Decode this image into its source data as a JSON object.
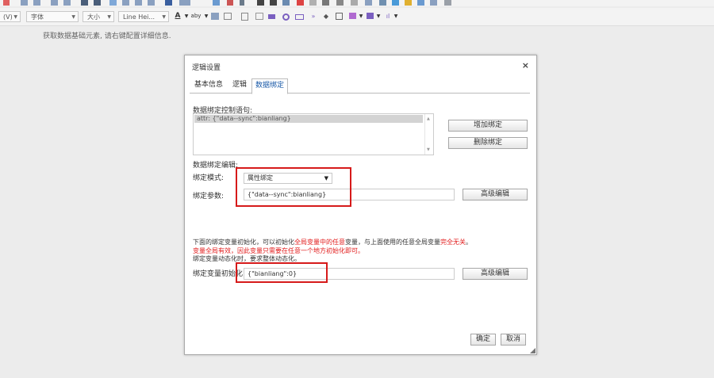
{
  "toolbar_top": {
    "icons": [
      "format-icon",
      "list-icon",
      "list-icon",
      "indent-icon",
      "indent-icon",
      "quote-icon",
      "bold-icon",
      "align-left-icon",
      "align-center-icon",
      "align-right-icon",
      "align-justify-icon",
      "text-color-icon",
      "highlight-icon",
      "link-icon",
      "unlink-icon",
      "anchor-icon",
      "image-icon",
      "video-icon",
      "map-icon",
      "code-icon",
      "template-icon",
      "chart-icon",
      "emoji-icon",
      "special-char-icon",
      "undo-icon",
      "redo-icon",
      "eraser-icon"
    ]
  },
  "toolbar": {
    "paragraph_label": "(V)",
    "font_family_label": "字体",
    "font_size_label": "大小",
    "line_height_label": "Line Hei...",
    "font_color_glyph": "A",
    "highlight_glyph": "aby"
  },
  "hint_text": "获取数据基础元素, 请右键配置详细信息.",
  "dialog": {
    "title": "逻辑设置",
    "close_glyph": "×",
    "tabs": [
      "基本信息",
      "逻辑",
      "数据绑定"
    ],
    "active_tab": 2,
    "binding_statements_label": "数据绑定控制语句:",
    "binding_statement_item": "attr: {\"data--sync\":bianliang}",
    "add_binding_button": "增加绑定",
    "delete_binding_button": "删除绑定",
    "binding_edit_label": "数据绑定编辑:",
    "binding_mode_label": "绑定模式:",
    "binding_mode_value": "属性绑定",
    "binding_params_label": "绑定参数:",
    "binding_params_value": "{\"data--sync\":bianliang}",
    "advanced_edit_button": "高级编辑",
    "note_line1": {
      "part1": "下面的绑定变量初始化，可以初始化",
      "part2": "全局变量中的任意",
      "part3": "变量，与上面使用的任意全局变量",
      "part4": "完全无关",
      "part5": "。"
    },
    "note_line2": "变量全局有效，因此变量只需要在任意一个地方初始化即可。",
    "note_line3": "绑定变量动态化时，要求整体动态化。",
    "init_label": "绑定变量初始化:",
    "init_value": "{\"bianliang\":0}",
    "advanced_edit_button2": "高级编辑",
    "ok_button": "确定",
    "cancel_button": "取消"
  },
  "colors": {
    "accent_red": "#d61a1a",
    "tab_active_text": "#1a5aa8",
    "note_red": "#e21b1b"
  }
}
